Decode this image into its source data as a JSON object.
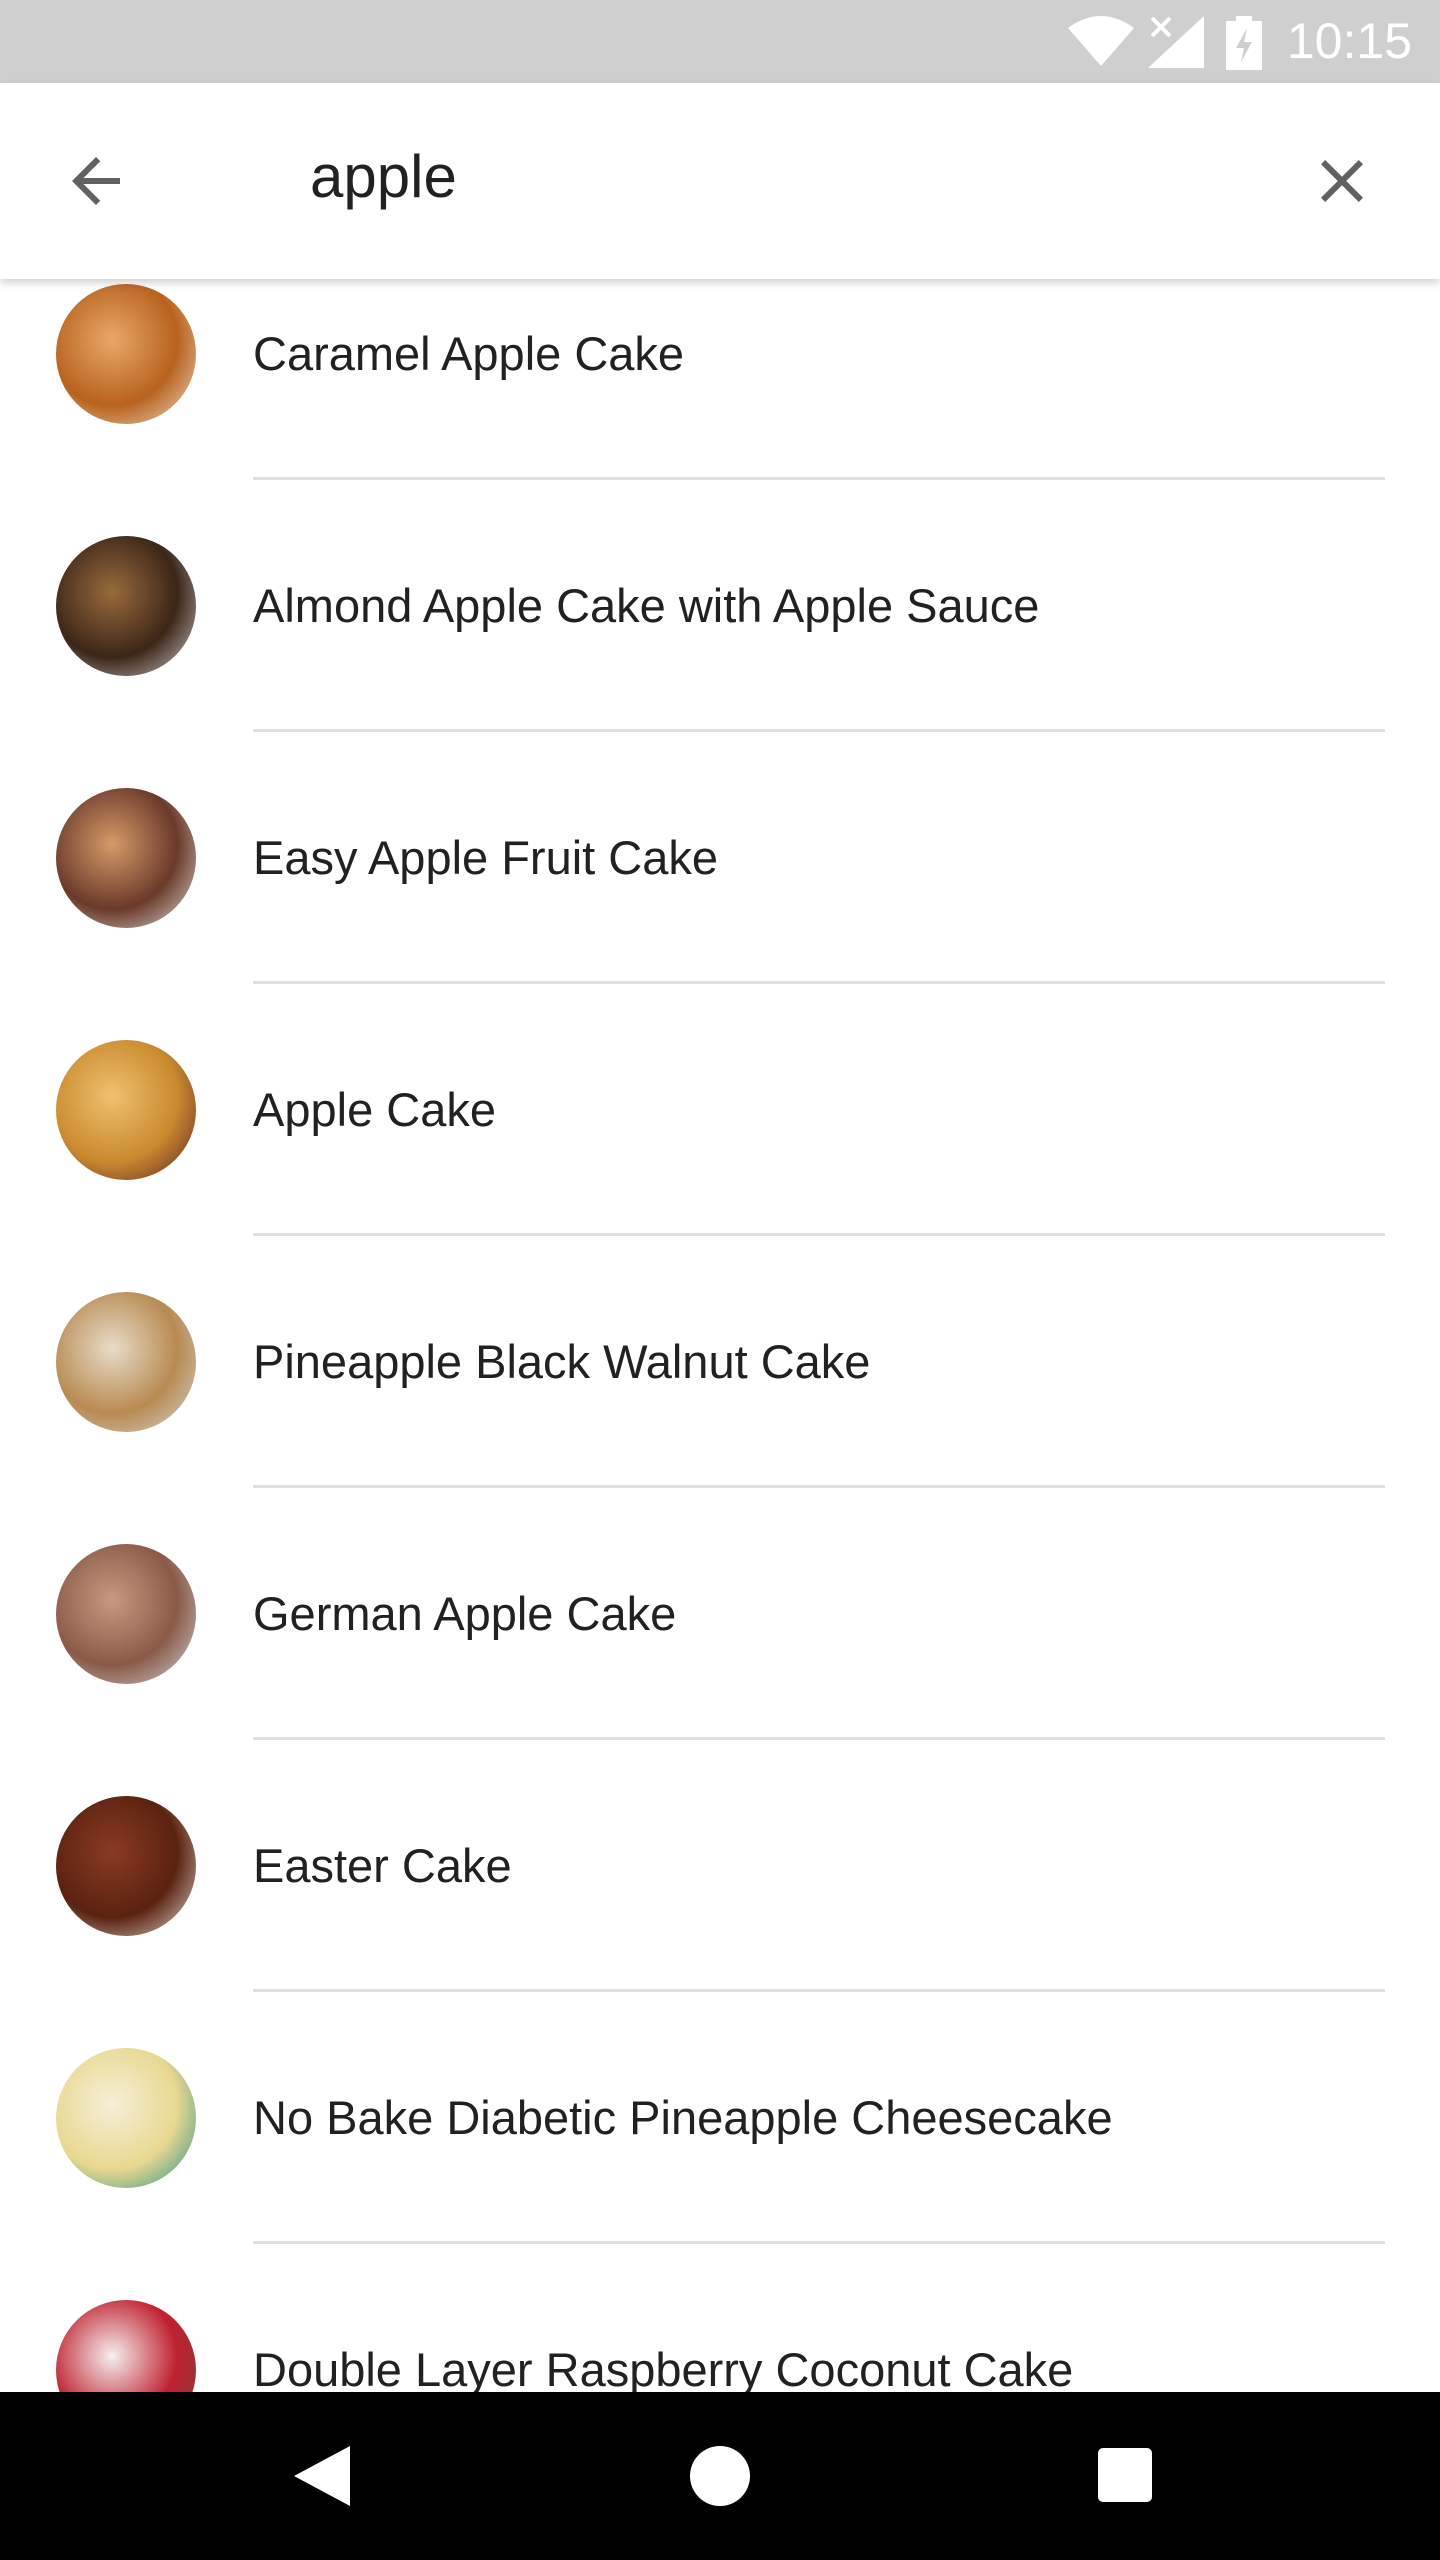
{
  "status_bar": {
    "time": "10:15",
    "icons": [
      "wifi-icon",
      "signal-no-data-icon",
      "battery-charging-icon"
    ]
  },
  "search": {
    "query": "apple",
    "back_icon": "arrow-back-icon",
    "clear_icon": "close-icon"
  },
  "results": [
    {
      "title": "Caramel Apple Cake",
      "thumb_colors": [
        "#e8a868",
        "#b8621e",
        "#f3e3cf"
      ]
    },
    {
      "title": "Almond Apple Cake with Apple Sauce",
      "thumb_colors": [
        "#9a6a3c",
        "#3b2618",
        "#d9d2d6"
      ]
    },
    {
      "title": "Easy Apple Fruit Cake",
      "thumb_colors": [
        "#d69a6a",
        "#6a3a2a",
        "#e6e2e0"
      ]
    },
    {
      "title": "Apple Cake",
      "thumb_colors": [
        "#f0c070",
        "#c98a2e",
        "#5a1c2a"
      ]
    },
    {
      "title": "Pineapple Black Walnut Cake",
      "thumb_colors": [
        "#e8dcc8",
        "#b88a52",
        "#d8d8d8"
      ]
    },
    {
      "title": "German Apple Cake",
      "thumb_colors": [
        "#c89a80",
        "#8a5a48",
        "#d7d9e0"
      ]
    },
    {
      "title": "Easter Cake",
      "thumb_colors": [
        "#8a3a22",
        "#5a2210",
        "#e8e0d8"
      ]
    },
    {
      "title": "No Bake Diabetic Pineapple Cheesecake",
      "thumb_colors": [
        "#f5f0d8",
        "#e8d890",
        "#1a8c88"
      ]
    },
    {
      "title": "Double Layer Raspberry Coconut Cake",
      "thumb_colors": [
        "#f4f0ee",
        "#c02030",
        "#6a4a3a"
      ]
    }
  ],
  "nav_bar": {
    "icons": [
      "back-triangle-icon",
      "home-circle-icon",
      "recents-square-icon"
    ]
  }
}
